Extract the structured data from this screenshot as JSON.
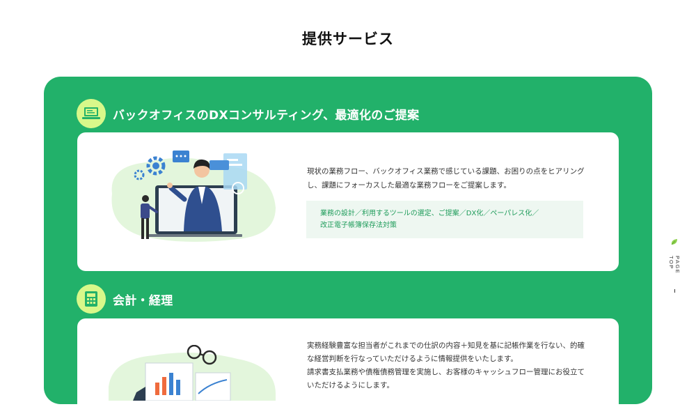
{
  "page": {
    "title": "提供サービス"
  },
  "sections": [
    {
      "icon": "laptop-icon",
      "title": "バックオフィスのDXコンサルティング、最適化のご提案",
      "description_lines": [
        "現状の業務フロー、バックオフィス業務で感じている課題、お困りの点をヒアリング",
        "し、課題にフォーカスした最適な業務フローをご提案します。"
      ],
      "tags_lines": [
        "業務の設計／利用するツールの選定、ご提案／DX化／ペーパレス化／",
        "改正電子帳簿保存法対策"
      ]
    },
    {
      "icon": "calculator-icon",
      "title": "会計・経理",
      "description_lines": [
        "実務経験豊富な担当者がこれまでの仕訳の内容＋知見を基に記帳作業を行ない、的確",
        "な経営判断を行なっていただけるように情報提供をいたします。",
        "請求書支払業務や債権債務管理を実施し、お客様のキャッシュフロー管理にお役立て",
        "いただけるようにします。"
      ]
    }
  ],
  "page_top": {
    "label": "PAGE TOP",
    "icon": "leaf-icon"
  },
  "colors": {
    "accent_green": "#22b16a",
    "icon_bg": "#d8f88a",
    "tag_text": "#1f9c5b",
    "tag_bg": "#eef7f1"
  }
}
